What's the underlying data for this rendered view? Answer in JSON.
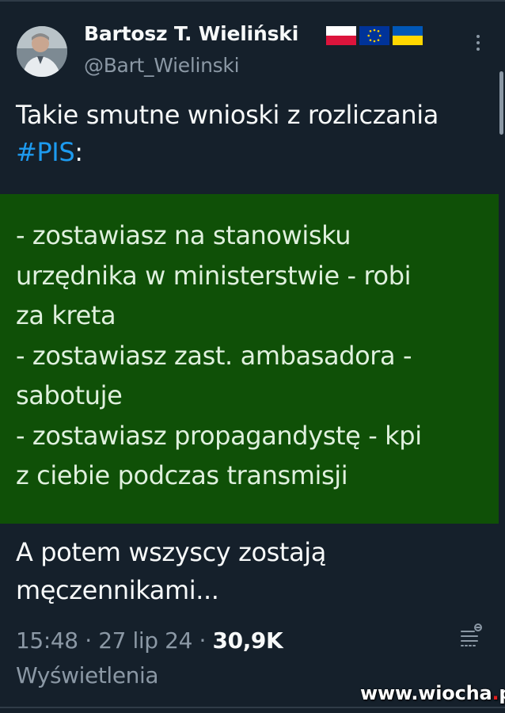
{
  "tweet": {
    "author_name": "Bartosz T. Wieliński",
    "author_handle": "@Bart_Wielinski",
    "flags": [
      "poland-flag-icon",
      "eu-flag-icon",
      "ukraine-flag-icon"
    ],
    "text_lines": [
      "Takie smutne wnioski z rozliczania"
    ],
    "hashtag": "#PIS",
    "hashtag_suffix": ":",
    "quote_lines": [
      "- zostawiasz na stanowisku",
      "urzędnika w ministerstwie - robi",
      "za kreta",
      "- zostawiasz zast. ambasadora -",
      "sabotuje",
      "- zostawiasz propagandystę - kpi",
      "z ciebie podczas transmisji"
    ],
    "tail_lines": [
      "A potem wszyscy zostają",
      "męczennikami..."
    ],
    "time": "15:48",
    "date": "27 lip 24",
    "views_count": "30,9K",
    "views_label": "Wyświetlenia",
    "sep": " · "
  },
  "watermark": {
    "prefix": "www.wiocha",
    "dot": ".",
    "suffix": "pl"
  },
  "colors": {
    "background": "#15202b",
    "quote_bg": "#0f5007",
    "hashtag": "#1d9bf0",
    "muted": "#8b98a5"
  }
}
